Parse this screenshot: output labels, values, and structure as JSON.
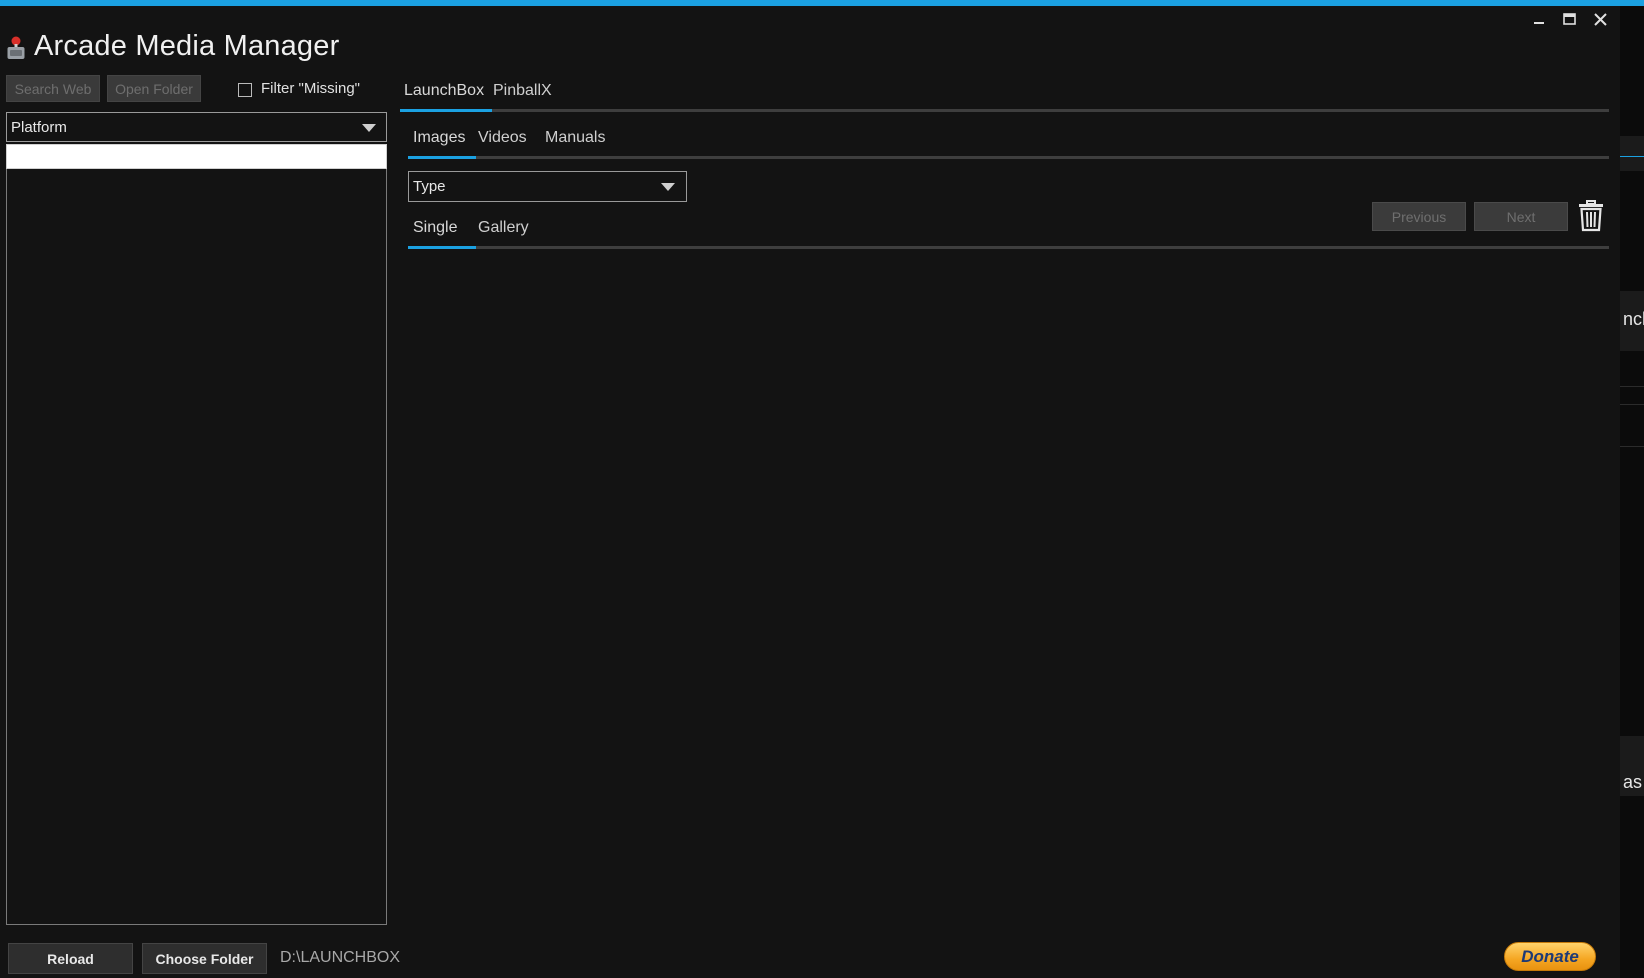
{
  "app": {
    "title": "Arcade Media Manager",
    "accent_color": "#1ba1e2"
  },
  "window_controls": {
    "minimize_icon": "minimize-icon",
    "maximize_icon": "maximize-icon",
    "close_icon": "close-icon"
  },
  "toolbar": {
    "search_web_label": "Search Web",
    "open_folder_label": "Open Folder",
    "filter_label": "Filter \"Missing\"",
    "filter_checked": false
  },
  "platform_select": {
    "value": "Platform"
  },
  "search": {
    "value": ""
  },
  "source_tabs": [
    {
      "label": "LaunchBox",
      "active": true
    },
    {
      "label": "PinballX",
      "active": false
    }
  ],
  "media_tabs": [
    {
      "label": "Images",
      "active": true
    },
    {
      "label": "Videos",
      "active": false
    },
    {
      "label": "Manuals",
      "active": false
    }
  ],
  "type_select": {
    "value": "Type"
  },
  "view_tabs": [
    {
      "label": "Single",
      "active": true
    },
    {
      "label": "Gallery",
      "active": false
    }
  ],
  "navigation": {
    "previous_label": "Previous",
    "next_label": "Next",
    "delete_icon": "trash-icon"
  },
  "footer": {
    "reload_label": "Reload",
    "choose_folder_label": "Choose Folder",
    "folder_path": "D:\\LAUNCHBOX",
    "donate_label": "Donate"
  },
  "background_window": {
    "fragment_1": "nch",
    "fragment_2": "as"
  }
}
